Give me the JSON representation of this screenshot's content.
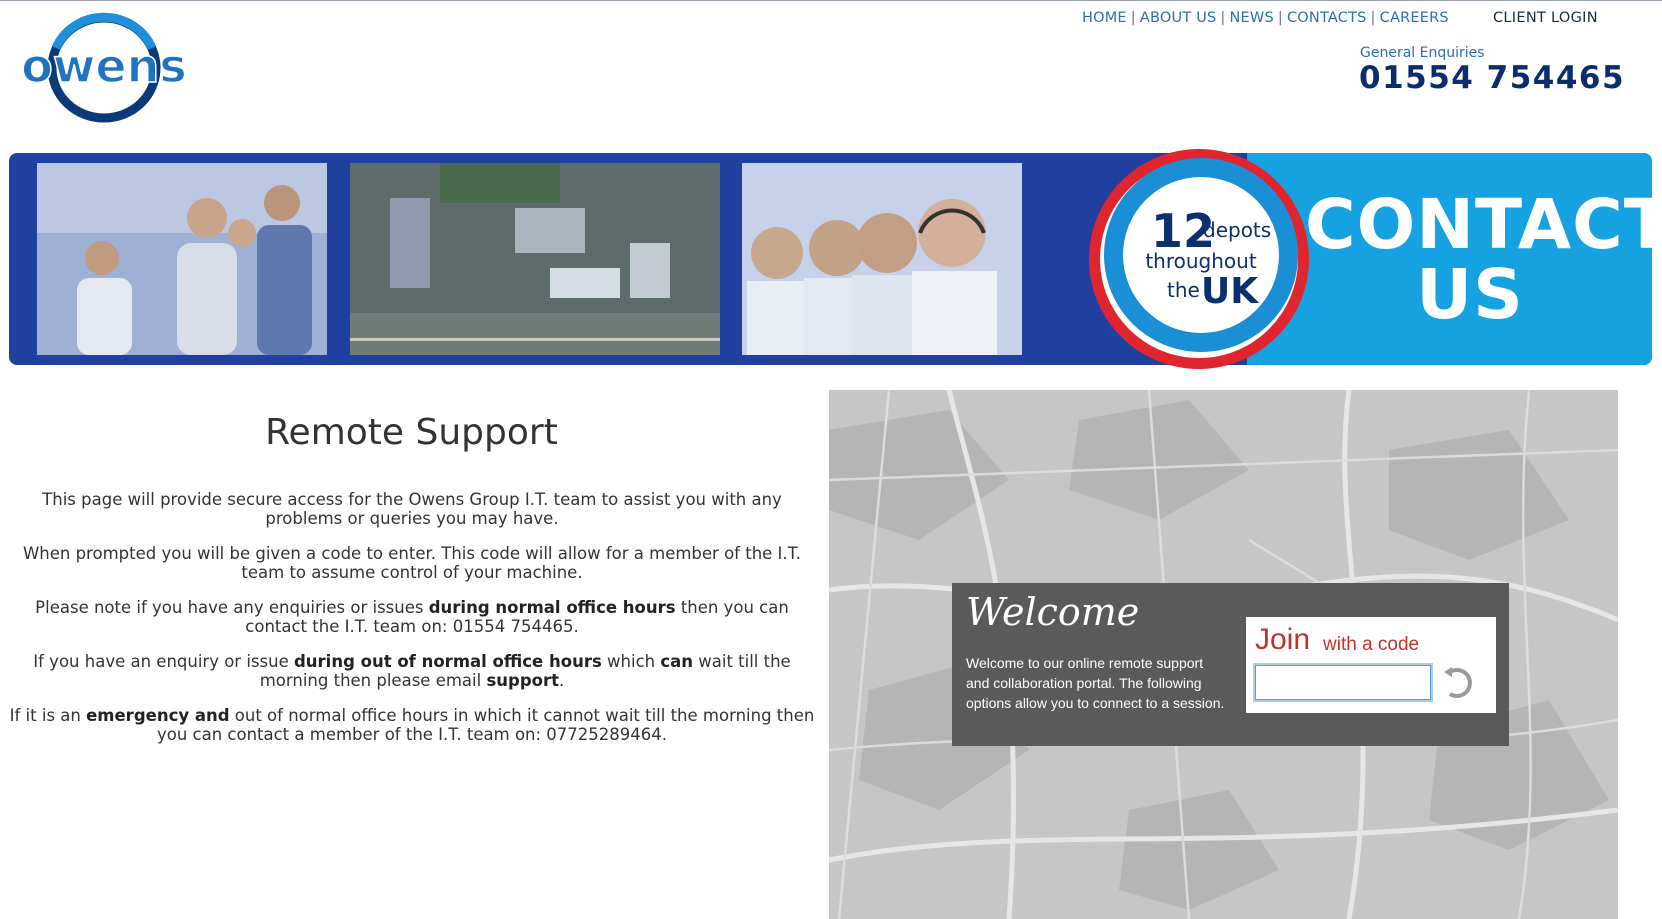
{
  "brand": {
    "logo_text": "owens"
  },
  "nav": {
    "items": [
      {
        "label": "HOME"
      },
      {
        "label": "ABOUT US"
      },
      {
        "label": "NEWS"
      },
      {
        "label": "CONTACTS"
      },
      {
        "label": "CAREERS"
      }
    ],
    "separator": "|",
    "client_login": "CLIENT LOGIN"
  },
  "enquiries": {
    "label": "General Enquiries",
    "phone": "01554 754465"
  },
  "banner": {
    "badge_number": "12",
    "badge_word": "depots",
    "badge_line2": "throughout",
    "badge_the": "the",
    "badge_uk": "UK",
    "contact_line1": "CONTACT",
    "contact_line2": "US"
  },
  "content": {
    "title": "Remote Support",
    "p1": "This page will provide secure access for the Owens Group I.T. team to assist you with any problems or queries you may have.",
    "p2": "When prompted you will be given a code to enter. This code will allow for a member of the I.T. team to assume control of your machine.",
    "p3_a": "Please note if you have any enquiries or issues ",
    "p3_b": "during normal office hours",
    "p3_c": " then you can contact the I.T. team on: 01554 754465.",
    "p4_a": "If you have an enquiry or issue ",
    "p4_b": "during out of normal office hours",
    "p4_c": " which ",
    "p4_d": "can",
    "p4_e": " wait till the morning then please email ",
    "p4_f": "support",
    "p4_g": ".",
    "p5_a": "If it is an ",
    "p5_b": "emergency and",
    "p5_c": " out of normal office hours in which it cannot wait till the morning then you can contact a member of the I.T. team on: 07725289464."
  },
  "portal": {
    "welcome_title": "Welcome",
    "welcome_text": "Welcome to our online remote support and collaboration portal. The following options allow you to connect to a session.",
    "join_big": "Join",
    "join_small": "with a code",
    "code_value": ""
  },
  "colors": {
    "nav_link": "#2a6fb6",
    "phone": "#0b2d6e",
    "banner_dark": "#2040a0",
    "banner_light": "#16a2e0",
    "badge_red": "#e1252f",
    "join_red": "#c1332a"
  }
}
